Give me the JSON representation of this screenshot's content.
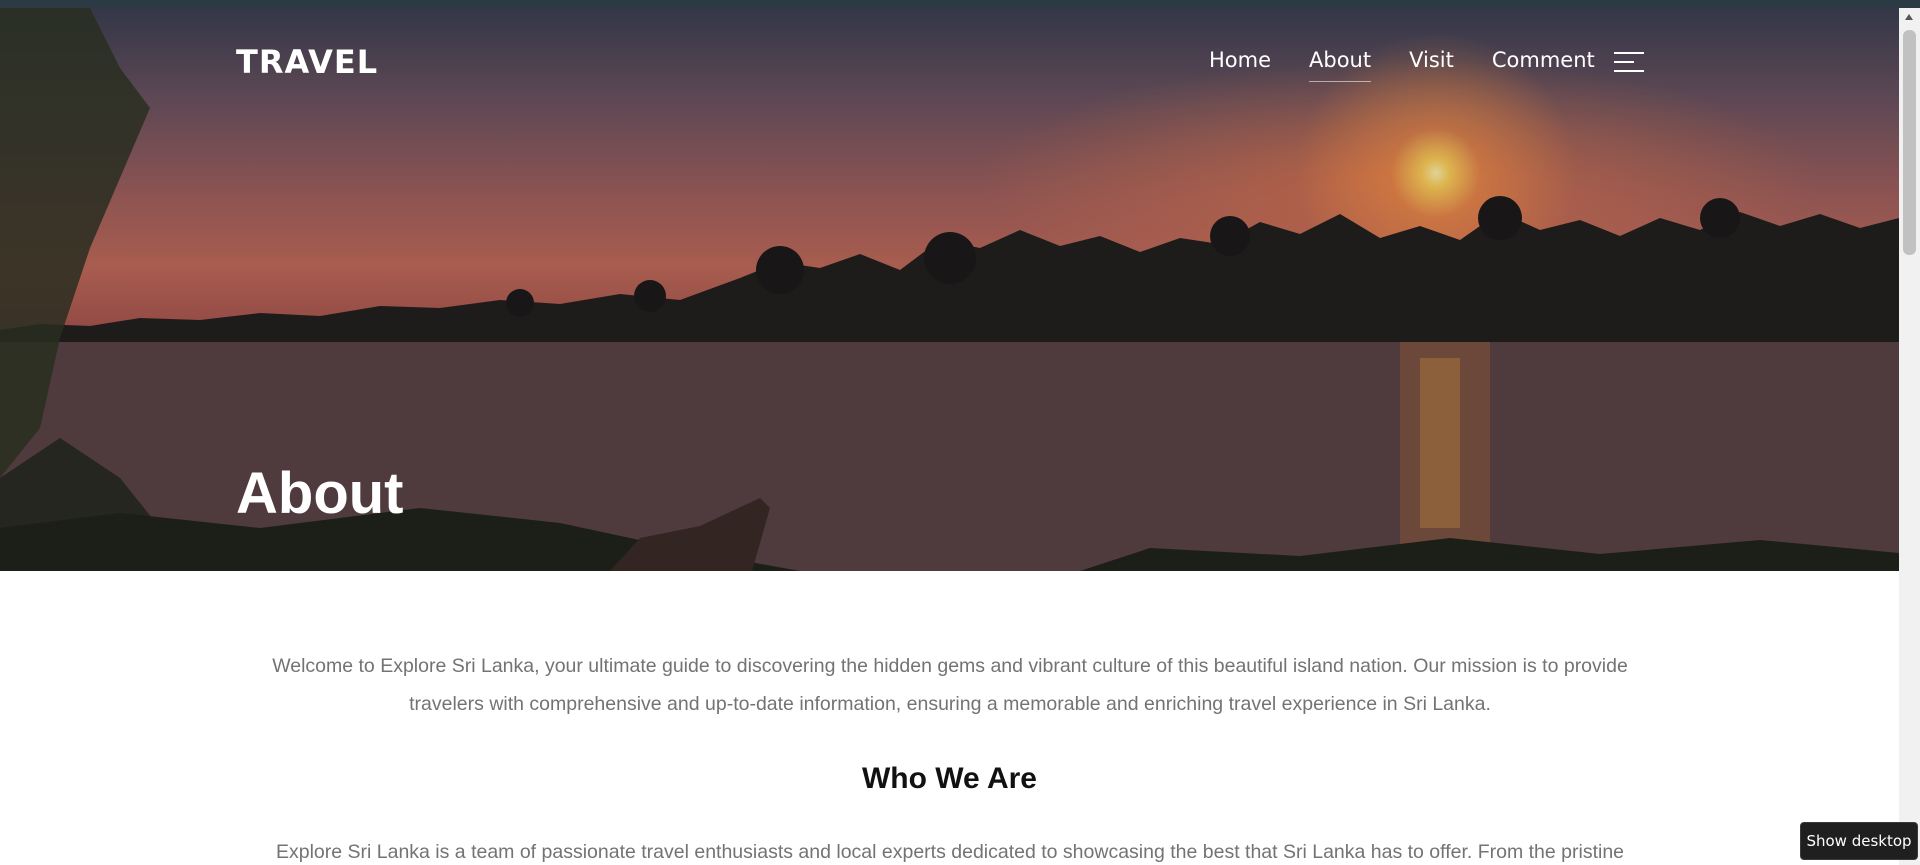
{
  "header": {
    "brand": "TRAVEL",
    "nav": [
      "Home",
      "About",
      "Visit",
      "Comment"
    ],
    "active_nav": "About",
    "menu_icon": "hamburger-menu-icon"
  },
  "hero": {
    "title": "About",
    "background": "sunset-lake-with-palm-trees-and-boat"
  },
  "main": {
    "intro": "Welcome to Explore Sri Lanka, your ultimate guide to discovering the hidden gems and vibrant culture of this beautiful island nation. Our mission is to provide travelers with comprehensive and up-to-date information, ensuring a memorable and enriching travel experience in Sri Lanka.",
    "section_heading": "Who We Are",
    "section_body": "Explore Sri Lanka is a team of passionate travel enthusiasts and local experts dedicated to showcasing the best that Sri Lanka has to offer. From the pristine"
  },
  "tooltip": "Show desktop",
  "colors": {
    "topstrip": "#2b3a43",
    "body_text": "#737373",
    "heading_text": "#111111"
  }
}
